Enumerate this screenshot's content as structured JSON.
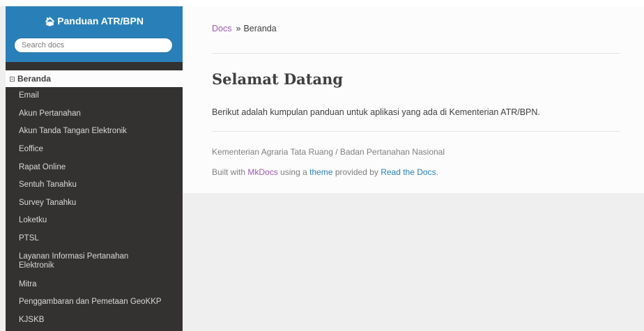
{
  "sidebar": {
    "brand": "Panduan ATR/BPN",
    "search_placeholder": "Search docs",
    "current": "Beranda",
    "items": [
      {
        "label": "Email"
      },
      {
        "label": "Akun Pertanahan"
      },
      {
        "label": "Akun Tanda Tangan Elektronik"
      },
      {
        "label": "Eoffice"
      },
      {
        "label": "Rapat Online"
      },
      {
        "label": "Sentuh Tanahku"
      },
      {
        "label": "Survey Tanahku"
      },
      {
        "label": "Loketku"
      },
      {
        "label": "PTSL"
      },
      {
        "label": "Layanan Informasi Pertanahan Elektronik"
      },
      {
        "label": "Mitra"
      },
      {
        "label": "Penggambaran dan Pemetaan GeoKKP"
      },
      {
        "label": "KJSKB"
      }
    ]
  },
  "breadcrumb": {
    "root": "Docs",
    "separator": "»",
    "current": "Beranda"
  },
  "main": {
    "title": "Selamat Datang",
    "intro": "Berikut adalah kumpulan panduan untuk aplikasi yang ada di Kementerian ATR/BPN."
  },
  "footer": {
    "org": "Kementerian Agraria Tata Ruang / Badan Pertanahan Nasional",
    "built_prefix": "Built with",
    "mkdocs": "MkDocs",
    "using_a": "using a",
    "theme": "theme",
    "provided_by": "provided by",
    "rtd": "Read the Docs",
    "end": "."
  },
  "colors": {
    "sidebar_bg": "#343131",
    "header_bg": "#2980b9",
    "link_purple": "#9b59b6",
    "link_blue": "#2980b9"
  }
}
